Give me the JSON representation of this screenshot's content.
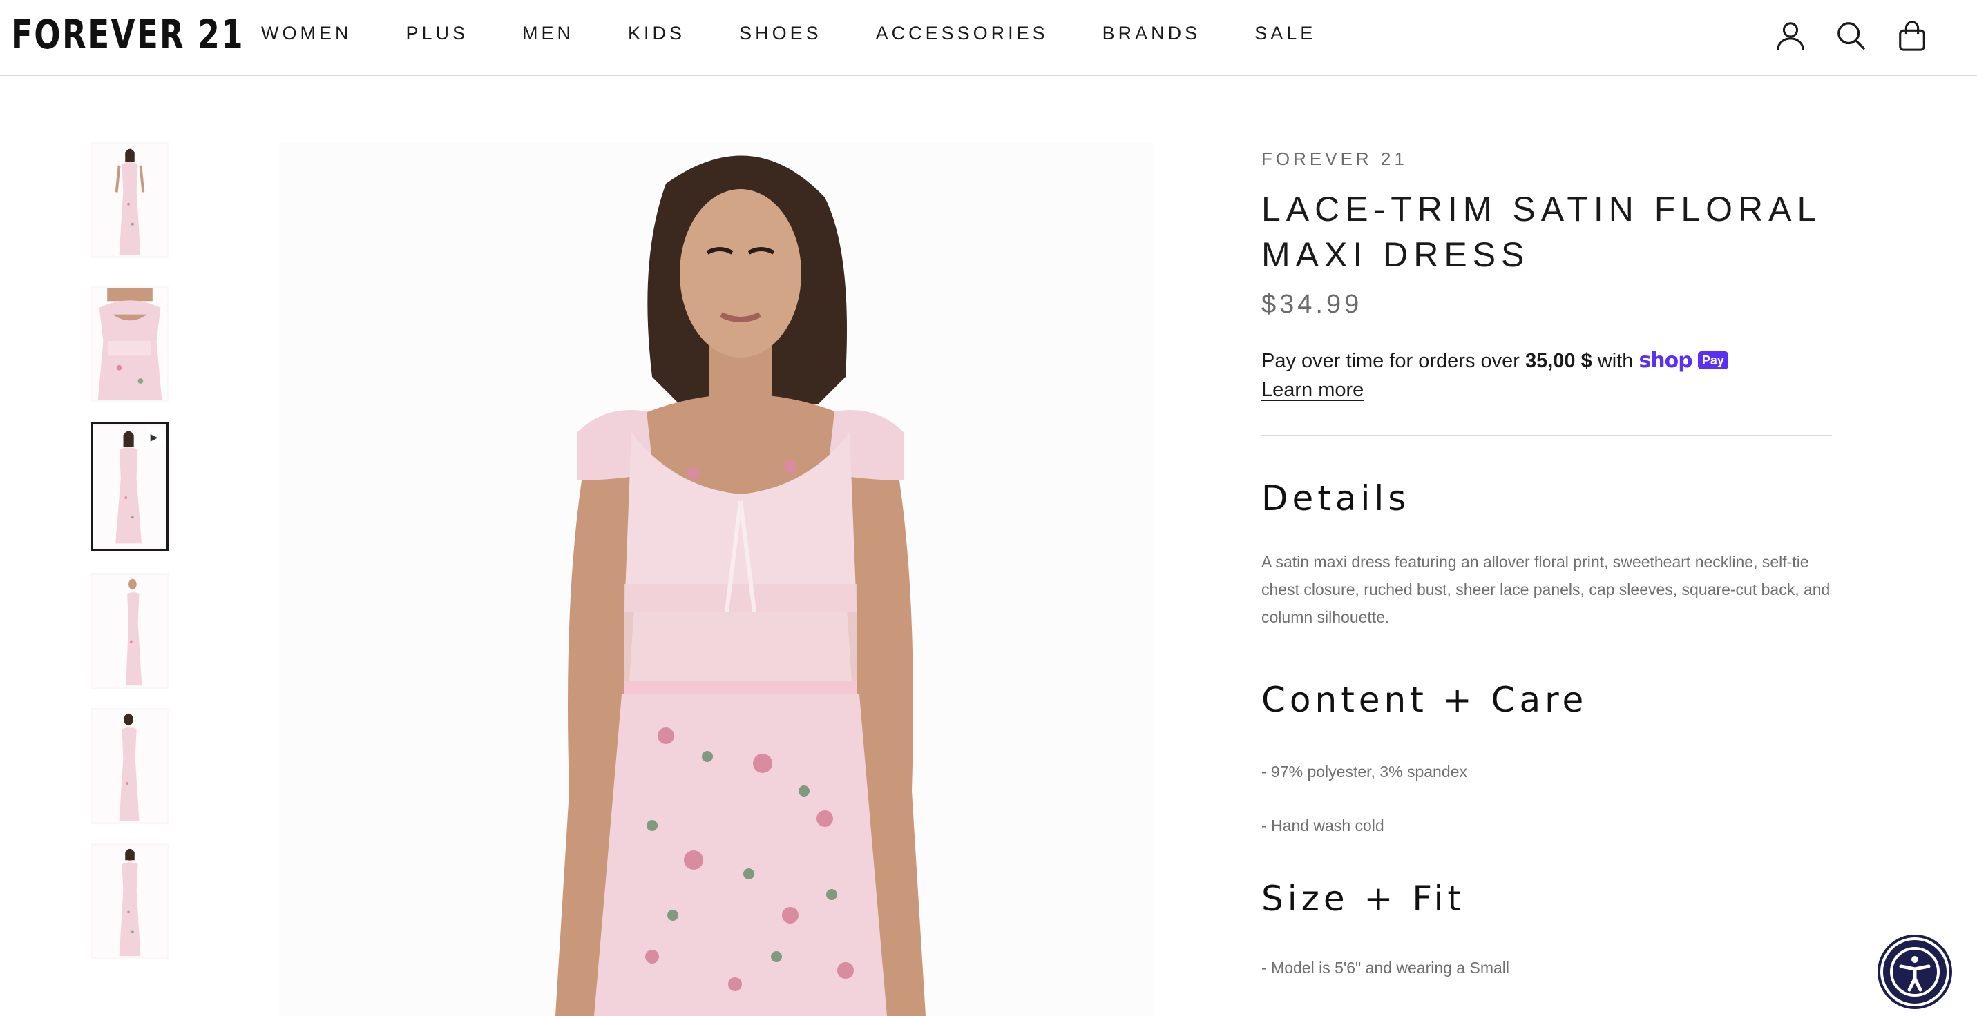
{
  "header": {
    "logo": "FOREVER 21",
    "nav": [
      "WOMEN",
      "PLUS",
      "MEN",
      "KIDS",
      "SHOES",
      "ACCESSORIES",
      "BRANDS",
      "SALE"
    ],
    "icons": [
      "account-icon",
      "search-icon",
      "bag-icon"
    ]
  },
  "gallery": {
    "thumbnails": [
      {
        "icon": "thumbnail-full-front",
        "active": false
      },
      {
        "icon": "thumbnail-bodice-closeup",
        "active": false
      },
      {
        "icon": "thumbnail-video",
        "active": true,
        "badge": "▶"
      },
      {
        "icon": "thumbnail-side",
        "active": false
      },
      {
        "icon": "thumbnail-back",
        "active": false
      },
      {
        "icon": "thumbnail-front-alt",
        "active": false
      }
    ]
  },
  "product": {
    "brand": "FOREVER 21",
    "title": "LACE-TRIM SATIN FLORAL MAXI DRESS",
    "price": "$34.99",
    "shoppay": {
      "text_before": "Pay over time for orders over ",
      "amount": "35,00 $",
      "text_after": " with ",
      "shop_word": "shop",
      "pay_word": "Pay",
      "learn_more": "Learn more"
    },
    "details": {
      "heading": "Details",
      "body": "A satin maxi dress featuring an allover floral print, sweetheart neckline, self-tie chest closure, ruched bust, sheer lace panels, cap sleeves, square-cut back, and column silhouette."
    },
    "care": {
      "heading": "Content + Care",
      "lines": [
        "- 97% polyester, 3% spandex",
        "- Hand wash cold"
      ]
    },
    "fit": {
      "heading": "Size + Fit",
      "lines": [
        "- Model is 5'6\" and wearing a Small"
      ]
    }
  },
  "colors": {
    "shop_pay_purple": "#5a31f4",
    "accessibility_navy": "#1c1e4e",
    "dress_pink": "#f3d3db",
    "text_gray": "#6f6f6f"
  }
}
